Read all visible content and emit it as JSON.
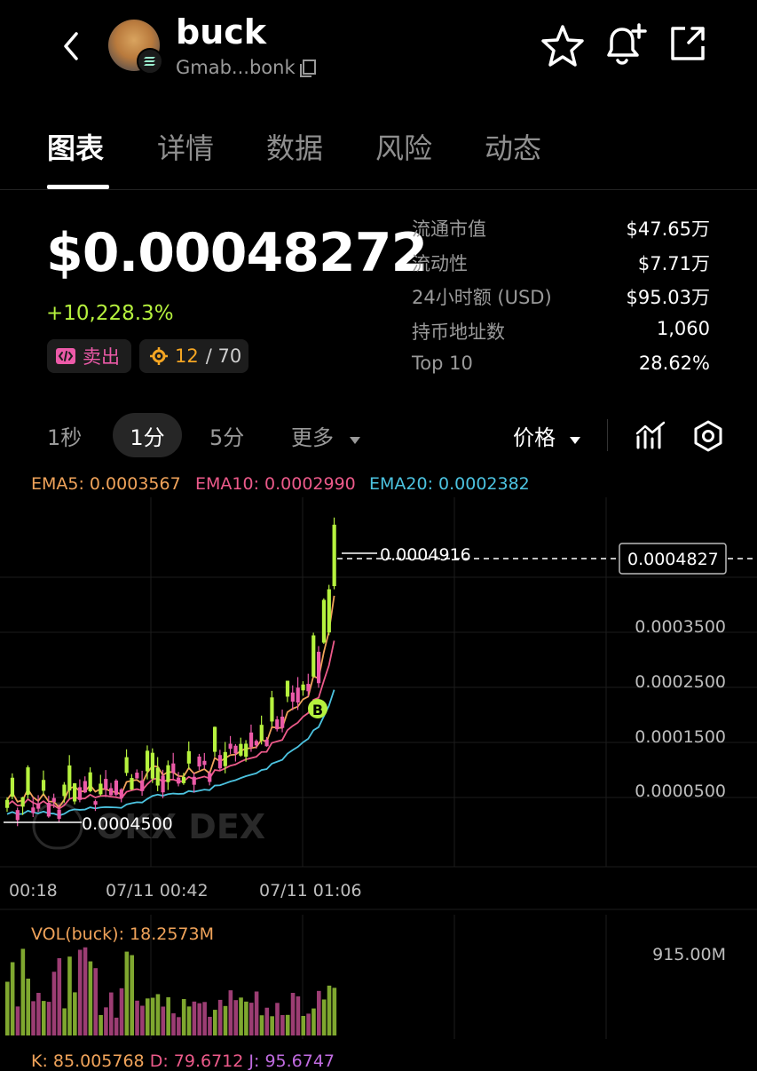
{
  "header": {
    "token_name": "buck",
    "address": "Gmab...bonk"
  },
  "tabs": [
    {
      "label": "图表",
      "active": true
    },
    {
      "label": "详情",
      "active": false
    },
    {
      "label": "数据",
      "active": false
    },
    {
      "label": "风险",
      "active": false
    },
    {
      "label": "动态",
      "active": false
    }
  ],
  "price": {
    "value": "$0.00048272",
    "change": "+10,228.3%",
    "sell_label": "卖出",
    "count_a": "12",
    "count_b": "/ 70"
  },
  "stats": [
    {
      "label": "流通市值",
      "value": "$47.65万"
    },
    {
      "label": "流动性",
      "value": "$7.71万"
    },
    {
      "label": "24小时额 (USD)",
      "value": "$95.03万"
    },
    {
      "label": "持币地址数",
      "value": "1,060"
    },
    {
      "label": "Top 10",
      "value": "28.62%"
    }
  ],
  "timeframes": {
    "t1": "1秒",
    "t2": "1分",
    "t3": "5分",
    "more": "更多",
    "price_mode": "价格"
  },
  "indicators": {
    "ema5": "EMA5: 0.0003567",
    "ema10": "EMA10: 0.0002990",
    "ema20": "EMA20: 0.0002382",
    "ema5_color": "#f0a35a",
    "ema10_color": "#ec5a8a",
    "ema20_color": "#4cc3e0"
  },
  "chart": {
    "high_label": "0.0004916",
    "current_label": "0.0004827",
    "low_label": "0.0004500",
    "y_ticks": [
      "0.0004500",
      "0.0003500",
      "0.0002500",
      "0.0001500",
      "0.0000500"
    ],
    "x_ticks": [
      "00:18",
      "07/11 00:42",
      "07/11 01:06"
    ],
    "buy_marker": "B",
    "watermark": "OKX DEX"
  },
  "volume": {
    "label": "VOL(buck): 18.2573M",
    "max_tick": "915.00M"
  },
  "kdj": {
    "k": "K: 85.005768",
    "d": "D: 79.6712",
    "j": "J: 95.6747"
  },
  "colors": {
    "up": "#b6f23e",
    "down": "#ec5aa8",
    "accent": "#f5a623"
  }
}
